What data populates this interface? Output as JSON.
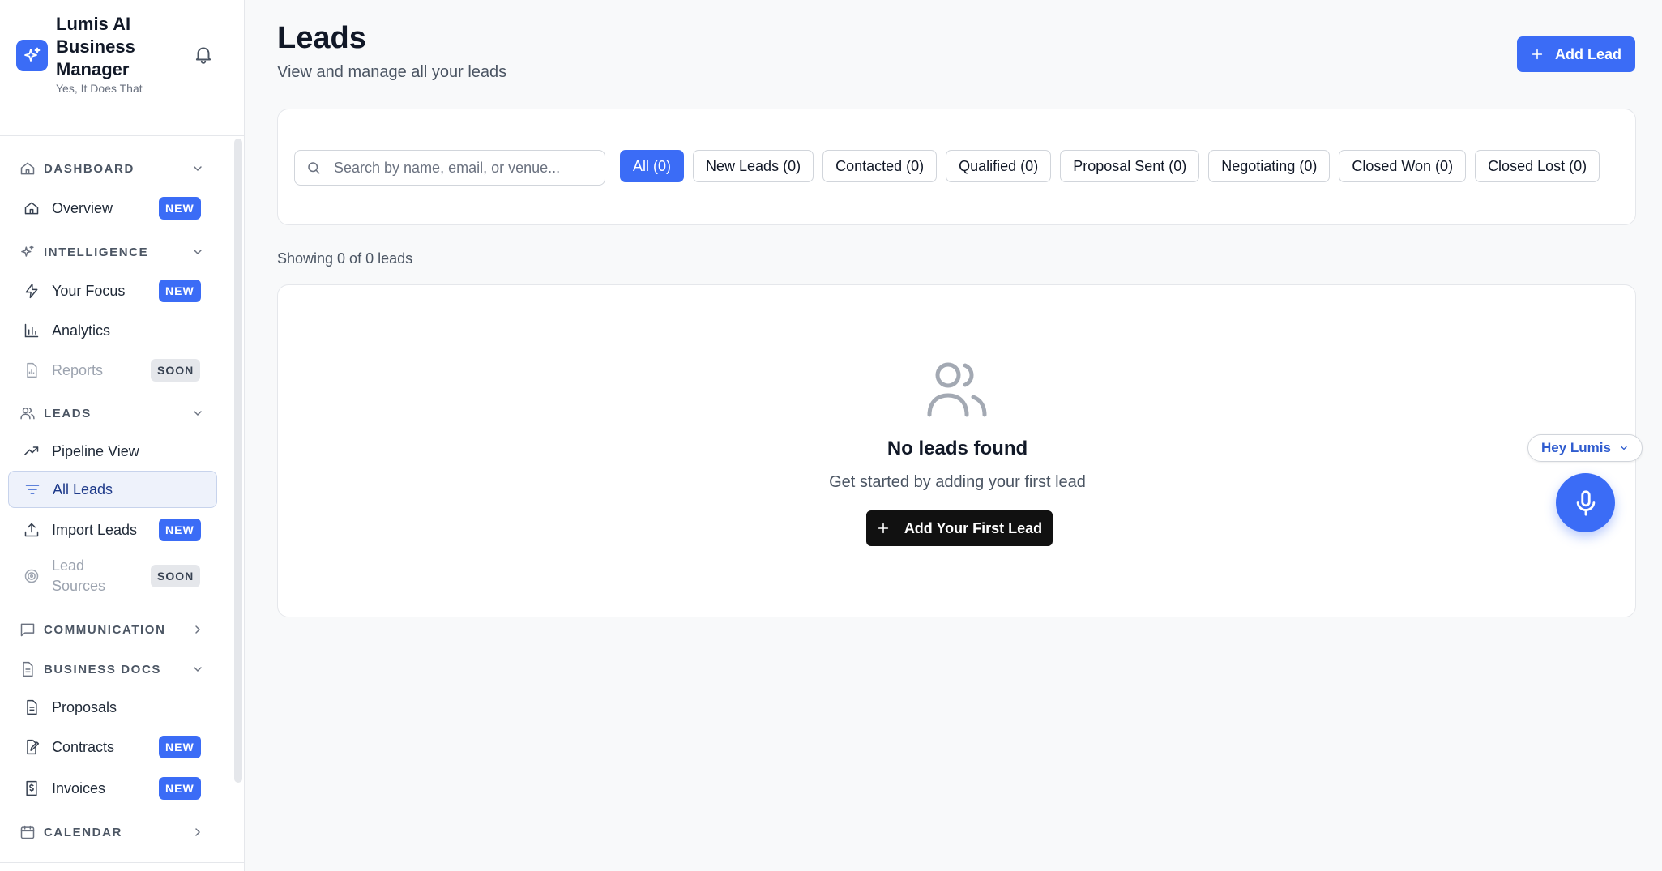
{
  "brand": {
    "title": "Lumis AI Business Manager",
    "subtitle": "Yes, It Does That",
    "logo_icon": "sparkles-icon",
    "accent_color": "#3b6cf6"
  },
  "sidebar": {
    "sections": {
      "dashboard": {
        "label": "DASHBOARD",
        "icon": "home-icon",
        "expanded": true
      },
      "intelligence": {
        "label": "INTELLIGENCE",
        "icon": "sparkles-icon",
        "expanded": true
      },
      "leads": {
        "label": "LEADS",
        "icon": "users-icon",
        "expanded": true
      },
      "communication": {
        "label": "COMMUNICATION",
        "icon": "chat-icon",
        "expanded": false
      },
      "business_docs": {
        "label": "BUSINESS DOCS",
        "icon": "document-icon",
        "expanded": true
      },
      "calendar": {
        "label": "CALENDAR",
        "icon": "calendar-icon",
        "expanded": false
      }
    },
    "items": {
      "overview": {
        "label": "Overview",
        "badge": "NEW"
      },
      "your_focus": {
        "label": "Your Focus",
        "badge": "NEW"
      },
      "analytics": {
        "label": "Analytics"
      },
      "reports": {
        "label": "Reports",
        "badge": "SOON",
        "disabled": true
      },
      "pipeline_view": {
        "label": "Pipeline View"
      },
      "all_leads": {
        "label": "All Leads",
        "active": true
      },
      "import_leads": {
        "label": "Import Leads",
        "badge": "NEW"
      },
      "lead_sources": {
        "label": "Lead Sources",
        "badge": "SOON",
        "disabled": true
      },
      "proposals": {
        "label": "Proposals"
      },
      "contracts": {
        "label": "Contracts",
        "badge": "NEW"
      },
      "invoices": {
        "label": "Invoices",
        "badge": "NEW"
      }
    }
  },
  "header": {
    "title": "Leads",
    "subtitle": "View and manage all your leads",
    "add_button": "Add Lead"
  },
  "search": {
    "placeholder": "Search by name, email, or venue...",
    "value": ""
  },
  "filters": [
    {
      "label": "All (0)",
      "active": true
    },
    {
      "label": "New Leads (0)"
    },
    {
      "label": "Contacted (0)"
    },
    {
      "label": "Qualified (0)"
    },
    {
      "label": "Proposal Sent (0)"
    },
    {
      "label": "Negotiating (0)"
    },
    {
      "label": "Closed Won (0)"
    },
    {
      "label": "Closed Lost (0)"
    }
  ],
  "results": {
    "summary": "Showing 0 of 0 leads"
  },
  "empty_state": {
    "icon": "users-icon",
    "title": "No leads found",
    "subtitle": "Get started by adding your first lead",
    "button": "Add Your First Lead"
  },
  "assistant": {
    "label": "Hey Lumis",
    "mic_icon": "microphone-icon"
  }
}
